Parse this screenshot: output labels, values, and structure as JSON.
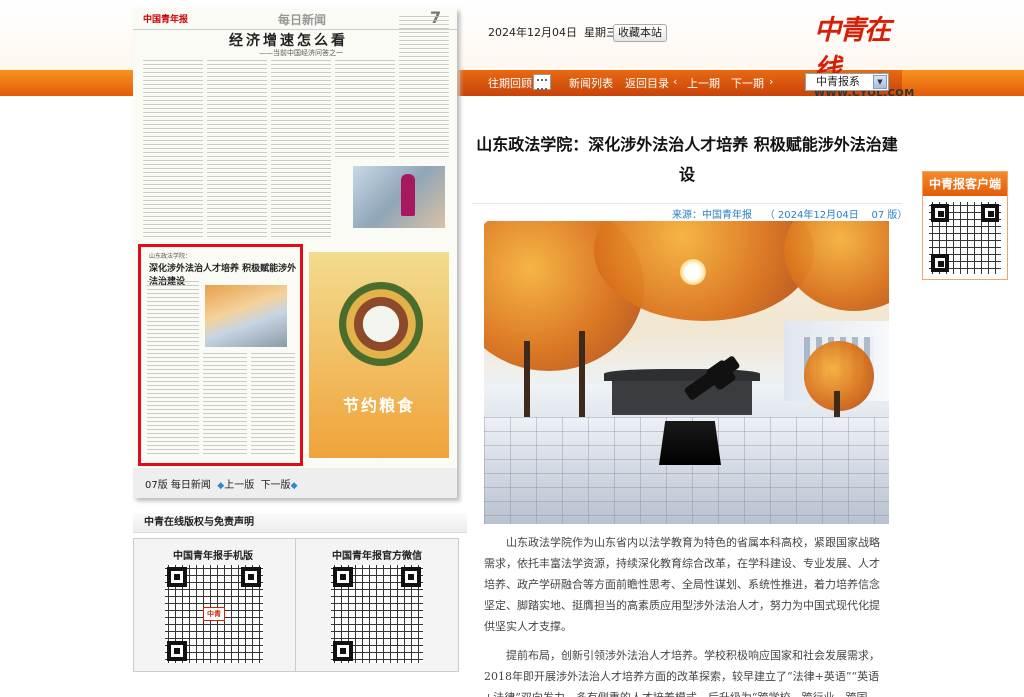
{
  "header": {
    "date": "2024年12月04日",
    "weekday": "星期三",
    "favorite_button": "收藏本站",
    "logo_text": "中青在线",
    "logo_url_text": "WWW.CYOL.COM"
  },
  "nav": {
    "past_review": "往期回顾",
    "news_list": "新闻列表",
    "back_to_index": "返回目录",
    "prev_issue": "上一期",
    "next_issue": "下一期",
    "prev_arrow": "‹",
    "next_arrow": "›",
    "paper_select": "中青报系",
    "select_arrow": "▼"
  },
  "paper": {
    "masthead": "中国青年报",
    "section": "每日新闻",
    "page_no": "7",
    "headline": "经济增速怎么看",
    "subhead": "——当前中国经济问答之一",
    "highlight_small": "山东政法学院：",
    "highlight_title": "深化涉外法治人才培养 积极赋能涉外法治建设",
    "food_caption": "节约粮食",
    "footer_page": "07版",
    "footer_section": "每日新闻",
    "footer_prev": "上一版",
    "footer_next": "下一版",
    "diamond": "◆"
  },
  "disclaimer": "中青在线版权与免责声明",
  "qr_left_title": "中国青年报手机版",
  "qr_right_title": "中国青年报官方微信",
  "client_title": "中青报客户端",
  "article": {
    "title": "山东政法学院：深化涉外法治人才培养 积极赋能涉外法治建设",
    "source_label": "来源：中国青年报",
    "source_date": "（ 2024年12月04日",
    "source_page": "07 版）",
    "p1": "山东政法学院作为山东省内以法学教育为特色的省属本科高校，紧跟国家战略需求，依托丰富法学资源，持续深化教育综合改革，在学科建设、专业发展、人才培养、政产学研融合等方面前瞻性思考、全局性谋划、系统性推进，着力培养信念坚定、脚踏实地、挺膺担当的高素质应用型涉外法治人才，努力为中国式现代化提供坚实人才支撑。",
    "p2": "提前布局，创新引领涉外法治人才培养。学校积极响应国家和社会发展需求，2018年即开展涉外法治人才培养方面的改革探索，较早建立了“法律+英语”“英语+法律”双向发力，多有侧重的人才培养模式，后升级为“跨学校、跨行业、跨国"
  }
}
